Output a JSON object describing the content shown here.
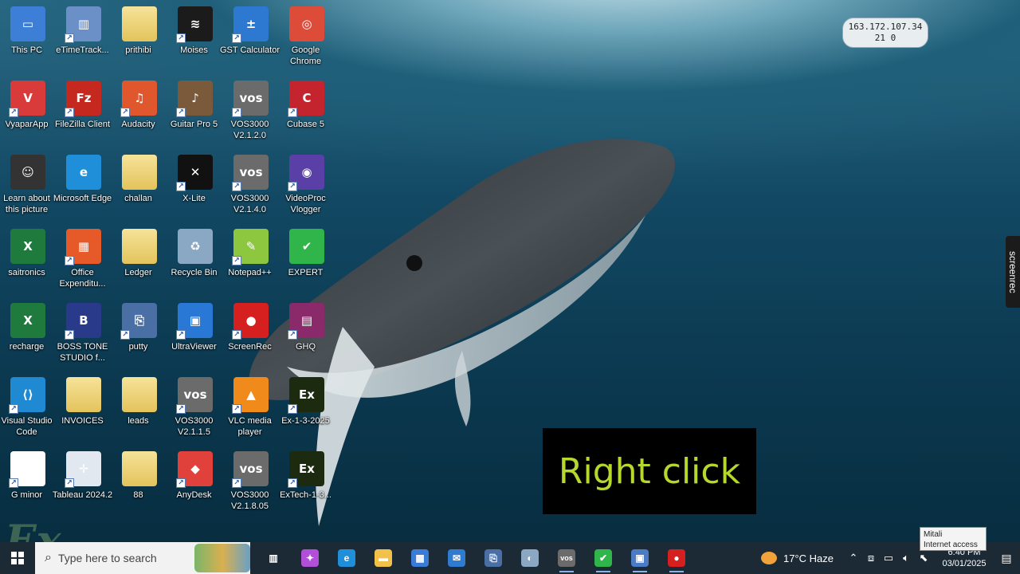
{
  "desktop": {
    "icons": [
      {
        "label": "This PC",
        "icon": "pc-icon",
        "color": "#3d7fd6"
      },
      {
        "label": "eTimeTrack...",
        "icon": "bars-icon",
        "color": "#6b8fc7"
      },
      {
        "label": "prithibi",
        "icon": "folder-icon",
        "color": "#e8c766"
      },
      {
        "label": "Moises",
        "icon": "moises-icon",
        "color": "#1b1b1b"
      },
      {
        "label": "GST Calculator",
        "icon": "calculator-icon",
        "color": "#2d78d1"
      },
      {
        "label": "Google Chrome",
        "icon": "chrome-icon",
        "color": "#dd4b39"
      },
      {
        "label": "VyaparApp",
        "icon": "vyapar-icon",
        "color": "#d93a3a"
      },
      {
        "label": "FileZilla Client",
        "icon": "filezilla-icon",
        "color": "#c4281e"
      },
      {
        "label": "Audacity",
        "icon": "audacity-icon",
        "color": "#e1572d"
      },
      {
        "label": "Guitar Pro 5",
        "icon": "guitar-icon",
        "color": "#7a5a3a"
      },
      {
        "label": "VOS3000 V2.1.2.0",
        "icon": "vos-icon",
        "color": "#6b6b6b"
      },
      {
        "label": "Cubase 5",
        "icon": "cubase-icon",
        "color": "#c3242d"
      },
      {
        "label": "Learn about this picture",
        "icon": "learn-icon",
        "color": "#333333"
      },
      {
        "label": "Microsoft Edge",
        "icon": "edge-icon",
        "color": "#1e8fd8"
      },
      {
        "label": "challan",
        "icon": "folder-icon",
        "color": "#e8c766"
      },
      {
        "label": "X-Lite",
        "icon": "xlite-icon",
        "color": "#111111"
      },
      {
        "label": "VOS3000 V2.1.4.0",
        "icon": "vos-icon",
        "color": "#6b6b6b"
      },
      {
        "label": "VideoProc Vlogger",
        "icon": "videoproc-icon",
        "color": "#5a3fa7"
      },
      {
        "label": "saitronics",
        "icon": "excel-icon",
        "color": "#1f7a3e"
      },
      {
        "label": "Office Expenditu...",
        "icon": "office-icon",
        "color": "#e65a2a"
      },
      {
        "label": "Ledger",
        "icon": "folder-icon",
        "color": "#e8c766"
      },
      {
        "label": "Recycle Bin",
        "icon": "recycle-bin-icon",
        "color": "#8aa7c4"
      },
      {
        "label": "Notepad++",
        "icon": "notepad-icon",
        "color": "#8dc63f"
      },
      {
        "label": "EXPERT",
        "icon": "check-icon",
        "color": "#2fb54a"
      },
      {
        "label": "recharge",
        "icon": "excel-icon",
        "color": "#1f7a3e"
      },
      {
        "label": "BOSS TONE STUDIO f...",
        "icon": "boss-icon",
        "color": "#2a3a8a"
      },
      {
        "label": "putty",
        "icon": "putty-icon",
        "color": "#4a6fa5"
      },
      {
        "label": "UltraViewer",
        "icon": "ultraviewer-icon",
        "color": "#2a78d6"
      },
      {
        "label": "ScreenRec",
        "icon": "screenrec-icon",
        "color": "#d6201f"
      },
      {
        "label": "GHQ",
        "icon": "winrar-icon",
        "color": "#8a2a6a"
      },
      {
        "label": "Visual Studio Code",
        "icon": "vscode-icon",
        "color": "#1f8ad2"
      },
      {
        "label": "INVOICES",
        "icon": "folder-icon",
        "color": "#e8c766"
      },
      {
        "label": "leads",
        "icon": "folder-icon",
        "color": "#e8c766"
      },
      {
        "label": "VOS3000 V2.1.1.5",
        "icon": "vos-icon",
        "color": "#6b6b6b"
      },
      {
        "label": "VLC media player",
        "icon": "vlc-icon",
        "color": "#f08a1a"
      },
      {
        "label": "Ex-1-3-2025",
        "icon": "ex-icon",
        "color": "#1c2a10"
      },
      {
        "label": "G minor",
        "icon": "media-icon",
        "color": "#ffffff"
      },
      {
        "label": "Tableau 2024.2",
        "icon": "tableau-icon",
        "color": "#e1e8f0"
      },
      {
        "label": "88",
        "icon": "folder-icon",
        "color": "#e8c766"
      },
      {
        "label": "AnyDesk",
        "icon": "anydesk-icon",
        "color": "#e0413a"
      },
      {
        "label": "VOS3000 V2.1.8.05",
        "icon": "vos-icon",
        "color": "#6b6b6b"
      },
      {
        "label": "ExTech-1-3...",
        "icon": "extech-icon",
        "color": "#1c2a10"
      }
    ]
  },
  "ip_box": {
    "line1": "163.172.107.34",
    "line2": "21 0"
  },
  "screenrec_tab": "screenrec",
  "caption": "Right click",
  "watermark": "Ex",
  "taskbar": {
    "search_placeholder": "Type here to search",
    "apps": [
      {
        "name": "task-view-icon",
        "glyph": "▥",
        "color": "#1c2a36"
      },
      {
        "name": "copilot-icon",
        "glyph": "✦",
        "color": "#b14fd8"
      },
      {
        "name": "edge-icon",
        "glyph": "e",
        "color": "#1e8fd8"
      },
      {
        "name": "file-explorer-icon",
        "glyph": "▬",
        "color": "#f2c14a"
      },
      {
        "name": "store-icon",
        "glyph": "▦",
        "color": "#3a7bd5"
      },
      {
        "name": "mail-icon",
        "glyph": "✉",
        "color": "#2f7bd0"
      },
      {
        "name": "network-app-icon",
        "glyph": "⎘",
        "color": "#4a6fa5"
      },
      {
        "name": "paint-icon",
        "glyph": "◐",
        "color": "#8aa7c4"
      },
      {
        "name": "vos-icon",
        "glyph": "vos",
        "color": "#6b6b6b"
      },
      {
        "name": "expert-check-icon",
        "glyph": "✔",
        "color": "#2fb54a"
      },
      {
        "name": "remote-desktop-icon",
        "glyph": "▣",
        "color": "#4a7bc4"
      },
      {
        "name": "screenrec-icon",
        "glyph": "●",
        "color": "#d6201f"
      }
    ],
    "weather": {
      "temp": "17°C",
      "condition": "Haze"
    },
    "clock": {
      "time": "6:40 PM",
      "date": "03/01/2025"
    },
    "tooltip": {
      "line1": "Mitali",
      "line2": "Internet access"
    }
  }
}
